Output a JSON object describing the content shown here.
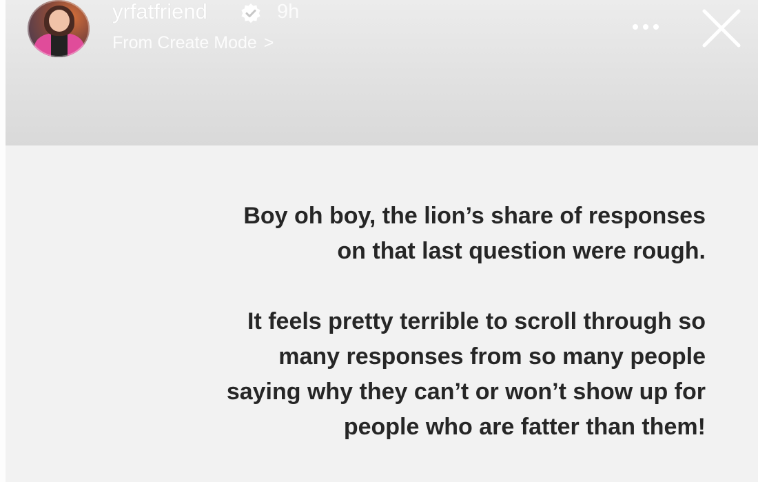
{
  "story": {
    "username": "yrfatfriend",
    "verified": true,
    "time": "9h",
    "source_label": "From Create Mode",
    "source_chevron": ">"
  },
  "icons": {
    "avatar": "profile-avatar",
    "verified": "verified-badge-icon",
    "more": "more-options-icon",
    "close": "close-icon"
  },
  "content": {
    "paragraph1": [
      "Boy oh boy, the lion’s share of responses",
      "on that last question were rough."
    ],
    "paragraph2": [
      "It feels pretty terrible to scroll through so",
      "many responses from so many people",
      "saying why they can’t or won’t show up for",
      "people who are fatter than them!"
    ]
  },
  "colors": {
    "background": "#f2f2f2",
    "text": "#262626",
    "header_text": "#ffffff"
  }
}
